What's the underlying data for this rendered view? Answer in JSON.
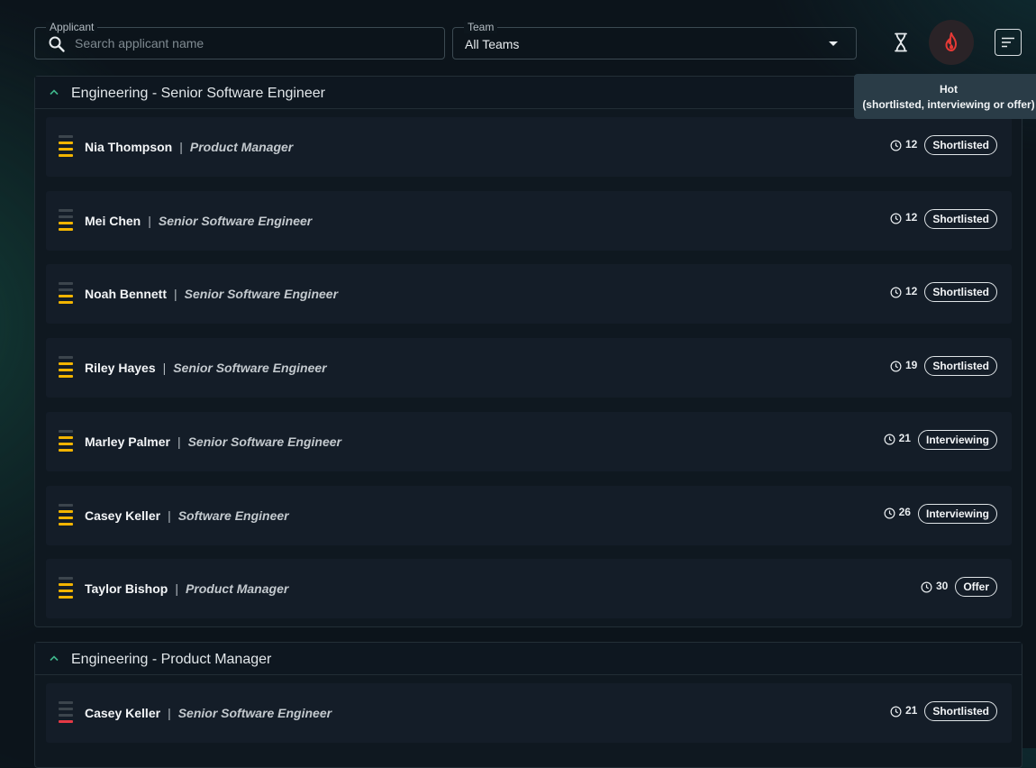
{
  "filters": {
    "applicant_label": "Applicant",
    "applicant_placeholder": "Search applicant name",
    "team_label": "Team",
    "team_value": "All Teams"
  },
  "toolbar": {
    "hourglass_icon": "hourglass-icon",
    "hot_icon": "flame-icon",
    "sort_icon": "sort-lines-icon"
  },
  "tooltip": {
    "title": "Hot",
    "subtitle": "(shortlisted, interviewing or offer)"
  },
  "colors": {
    "hot_accent": "#e53935",
    "rating_fill": "#f2b400",
    "rating_low": "#e53945",
    "rating_empty": "#3c454d"
  },
  "groups": [
    {
      "title": "Engineering - Senior Software Engineer",
      "applicants": [
        {
          "name": "Nia Thompson",
          "role": "Product Manager",
          "days": "12",
          "status": "Shortlisted",
          "rating": 3
        },
        {
          "name": "Mei Chen",
          "role": "Senior Software Engineer",
          "days": "12",
          "status": "Shortlisted",
          "rating": 2
        },
        {
          "name": "Noah Bennett",
          "role": "Senior Software Engineer",
          "days": "12",
          "status": "Shortlisted",
          "rating": 2
        },
        {
          "name": "Riley Hayes",
          "role": "Senior Software Engineer",
          "days": "19",
          "status": "Shortlisted",
          "rating": 3
        },
        {
          "name": "Marley Palmer",
          "role": "Senior Software Engineer",
          "days": "21",
          "status": "Interviewing",
          "rating": 3
        },
        {
          "name": "Casey Keller",
          "role": "Software Engineer",
          "days": "26",
          "status": "Interviewing",
          "rating": 3
        },
        {
          "name": "Taylor Bishop",
          "role": "Product Manager",
          "days": "30",
          "status": "Offer",
          "rating": 3
        }
      ]
    },
    {
      "title": "Engineering - Product Manager",
      "applicants": [
        {
          "name": "Casey Keller",
          "role": "Senior Software Engineer",
          "days": "21",
          "status": "Shortlisted",
          "rating": 1
        }
      ]
    }
  ]
}
